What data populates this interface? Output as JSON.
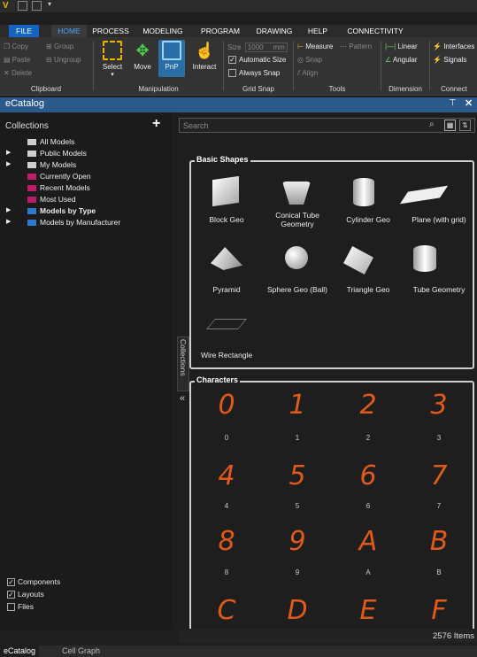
{
  "menu": {
    "tabs": [
      "FILE",
      "HOME",
      "PROCESS",
      "MODELING",
      "PROGRAM",
      "DRAWING",
      "HELP",
      "CONNECTIVITY"
    ]
  },
  "ribbon": {
    "clipboard": {
      "items": [
        "Copy",
        "Paste",
        "Delete",
        "Group",
        "Ungroup"
      ],
      "label": "Clipboard"
    },
    "manipulation": {
      "buttons": [
        "Select",
        "Move",
        "PnP",
        "Interact"
      ],
      "label": "Manipulation"
    },
    "gridsnap": {
      "size_label": "Size",
      "size_value": "1000",
      "size_unit": "mm",
      "auto_size": "Automatic Size",
      "always_snap": "Always Snap",
      "label": "Grid Snap"
    },
    "tools": {
      "items": [
        "Measure",
        "Pattern",
        "Snap",
        "Align"
      ],
      "label": "Tools"
    },
    "dimension": {
      "items": [
        "Linear",
        "Angular"
      ],
      "label": "Dimension"
    },
    "connect": {
      "items": [
        "Interfaces",
        "Signals"
      ],
      "label": "Connect"
    }
  },
  "panel": {
    "title": "eCatalog"
  },
  "collections": {
    "title": "Collections",
    "items": [
      "All Models",
      "Public Models",
      "My Models",
      "Currently Open",
      "Recent Models",
      "Most Used",
      "Models by Type",
      "Models by Manufacturer"
    ],
    "filters": [
      "Components",
      "Layouts",
      "Files"
    ]
  },
  "sidetab": "Collections",
  "search": {
    "placeholder": "Search"
  },
  "basic_shapes": {
    "title": "Basic Shapes",
    "items": [
      "Block Geo",
      "Conical Tube Geometry",
      "Cylinder Geo",
      "Plane (with grid)",
      "Pyramid",
      "Sphere Geo (Ball)",
      "Triangle Geo",
      "Tube Geometry",
      "Wire Rectangle"
    ]
  },
  "characters": {
    "title": "Characters",
    "items": [
      "0",
      "1",
      "2",
      "3",
      "4",
      "5",
      "6",
      "7",
      "8",
      "9",
      "A",
      "B",
      "C",
      "D",
      "E",
      "F"
    ],
    "captions": [
      "0",
      "1",
      "2",
      "3",
      "4",
      "5",
      "6",
      "7",
      "8",
      "9",
      "A",
      "B"
    ]
  },
  "status": {
    "count": "2576 Items"
  },
  "bottom_tabs": [
    "eCatalog",
    "Cell Graph"
  ],
  "colors": {
    "accent": "#1565c0",
    "panel_header": "#2b5a8a",
    "char": "#e05a1a"
  }
}
